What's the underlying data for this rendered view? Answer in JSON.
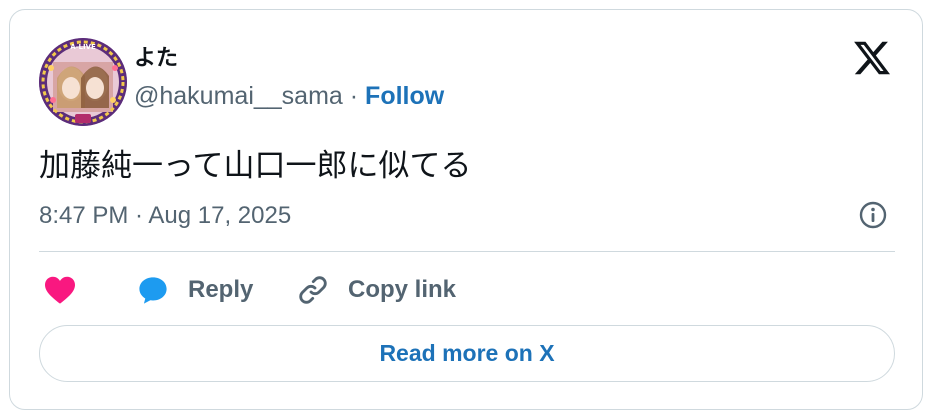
{
  "author": {
    "name": "よた",
    "handle": "@hakumai__sama",
    "separator": " · ",
    "follow_label": "Follow",
    "avatar_badge_text": "A-LIVE"
  },
  "tweet": {
    "text": "加藤純一って山口一郎に似てる",
    "timestamp": "8:47 PM · Aug 17, 2025"
  },
  "actions": {
    "like_icon": "heart-icon",
    "reply_label": "Reply",
    "copy_label": "Copy link"
  },
  "read_more_label": "Read more on X",
  "colors": {
    "like": "#f91880",
    "reply": "#1d9bf0",
    "link": "#1d72b8",
    "border": "#cfd9de",
    "text_secondary": "#536471"
  }
}
